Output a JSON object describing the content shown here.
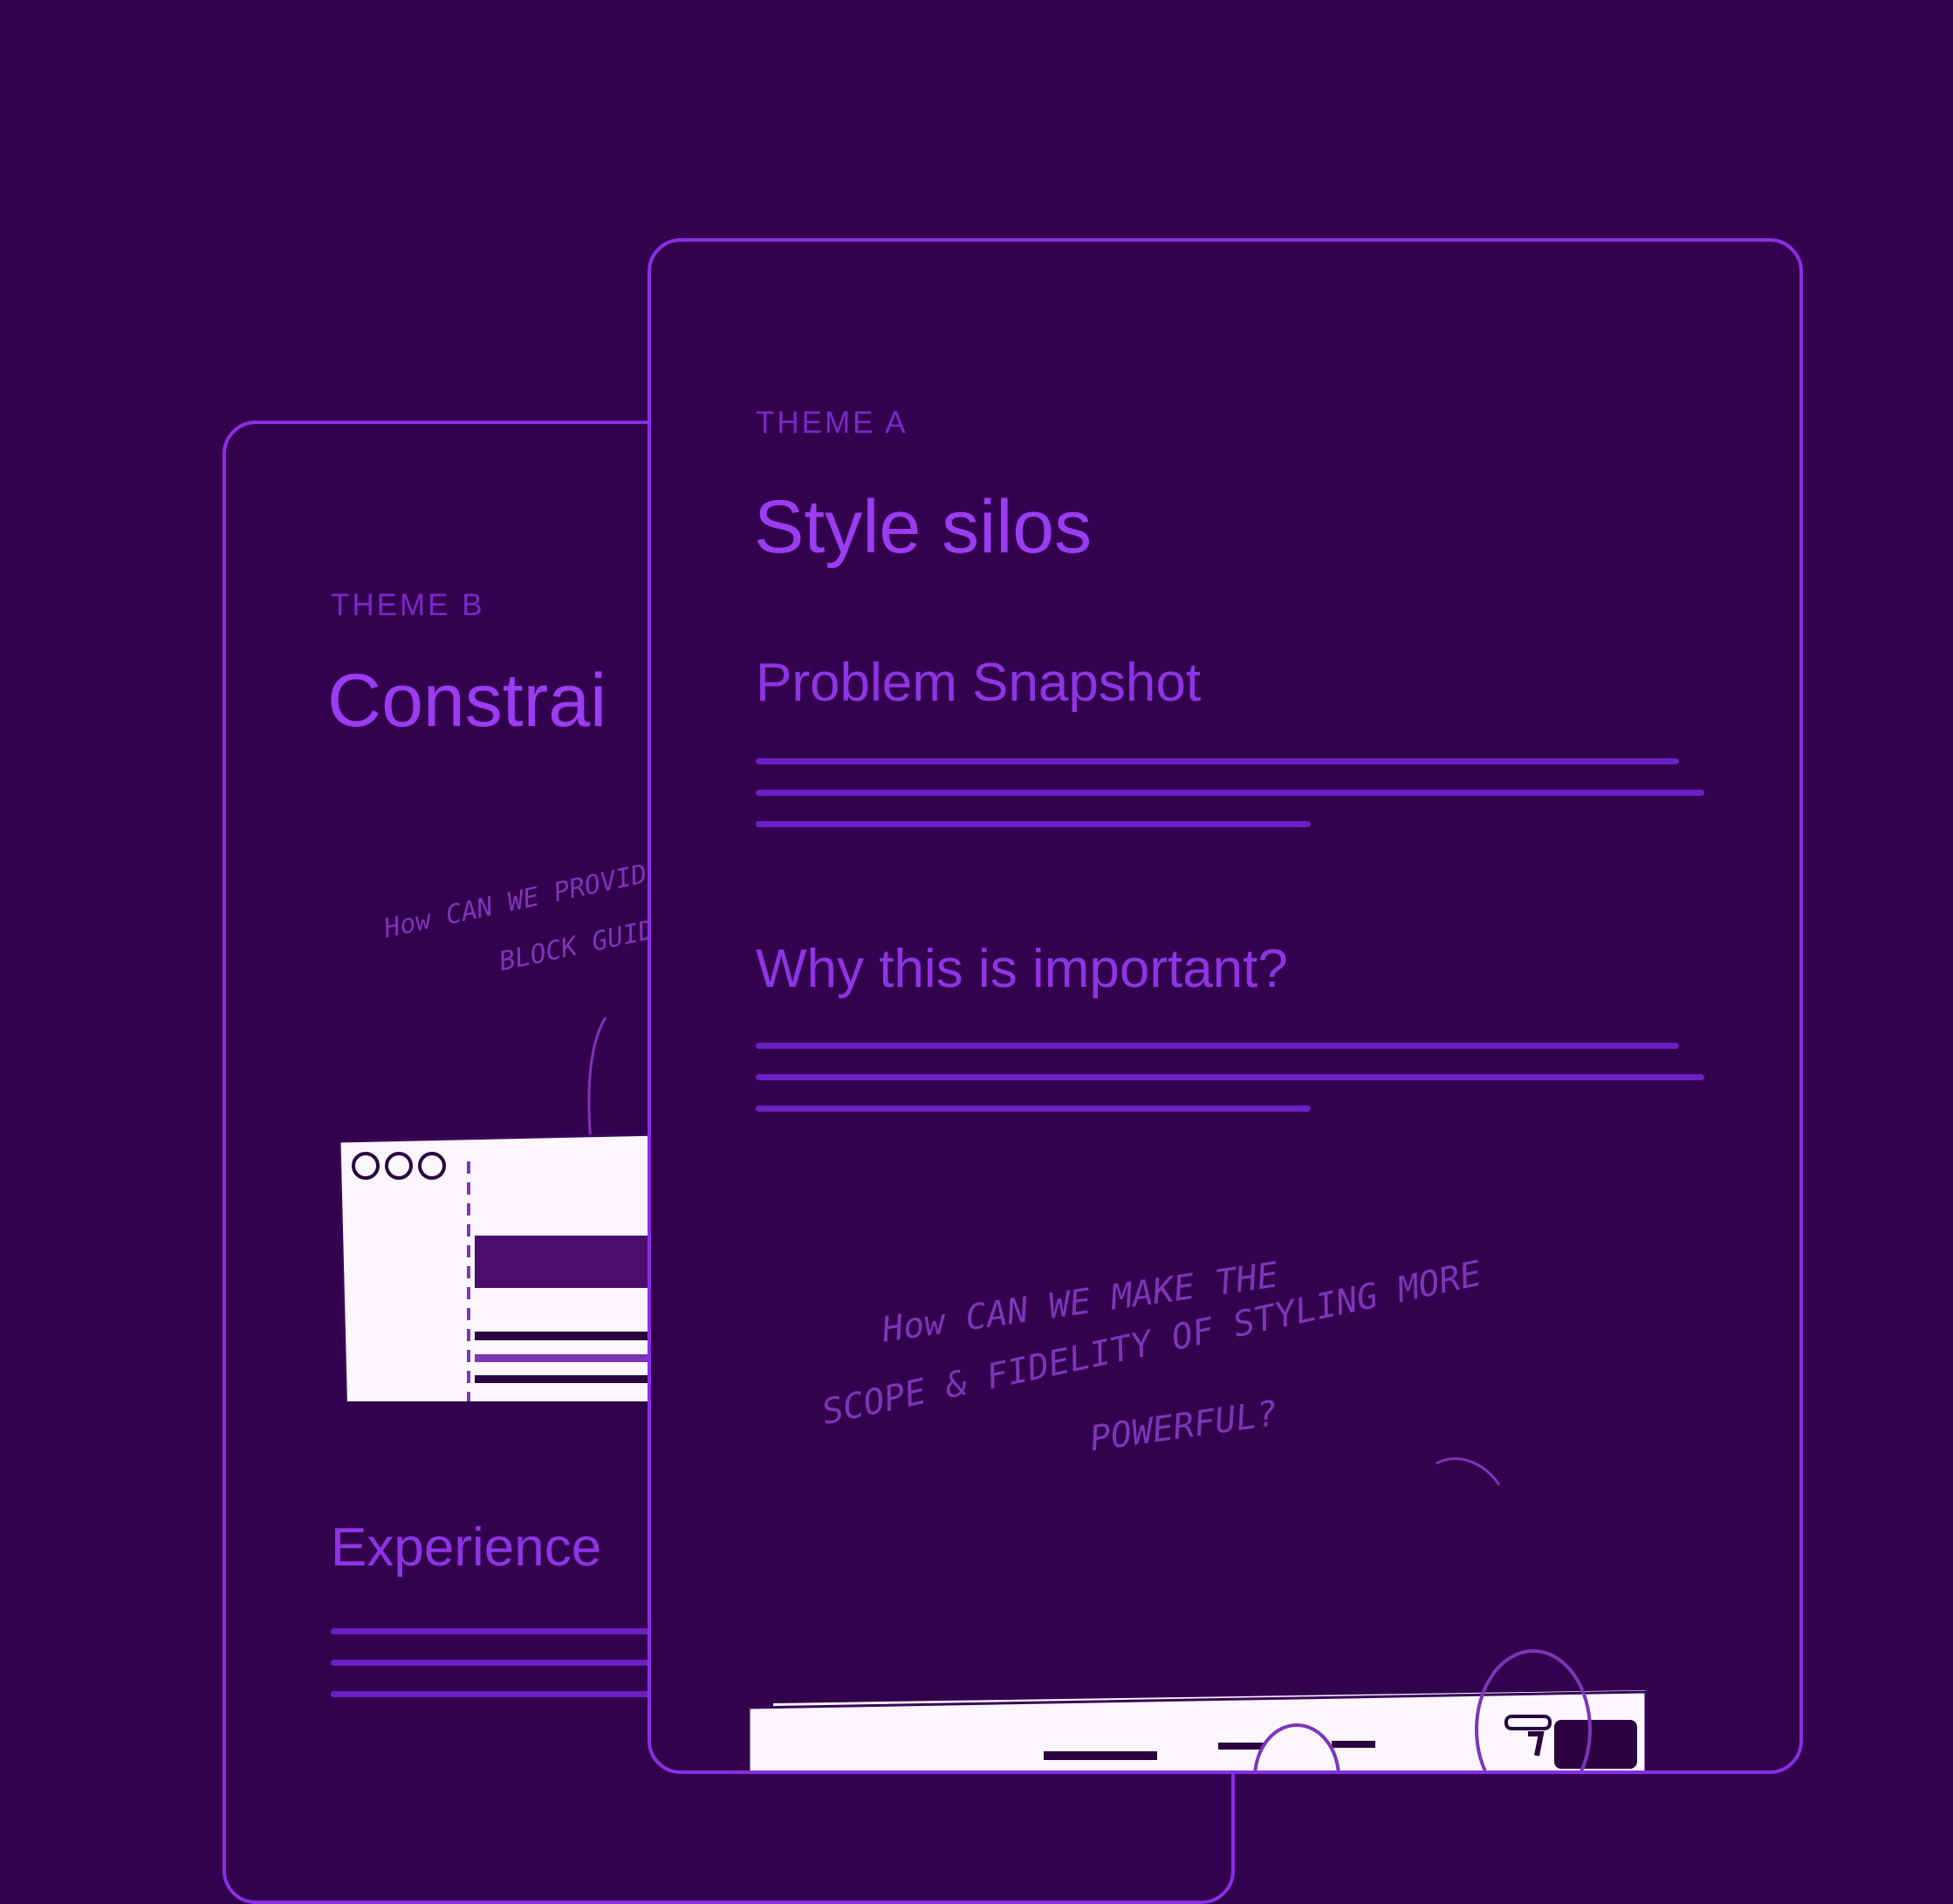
{
  "colors": {
    "background": "#33004d",
    "card_border": "#8a2ee6",
    "accent": "#9a3cf2",
    "muted": "#7a28c8"
  },
  "card_b": {
    "eyebrow": "THEME B",
    "title": "Constrai",
    "sketch_note_line1": "How CAN WE PROVIDE",
    "sketch_note_line2": "BLOCK GUIDE",
    "section": "Experience"
  },
  "card_a": {
    "eyebrow": "THEME A",
    "title": "Style silos",
    "section_problem": "Problem Snapshot",
    "section_why": "Why this is important?",
    "sketch_note_line1": "How CAN WE MAKE THE",
    "sketch_note_line2": "SCOPE & FIDELITY OF STYLING MORE",
    "sketch_note_line3": "POWERFUL?"
  }
}
